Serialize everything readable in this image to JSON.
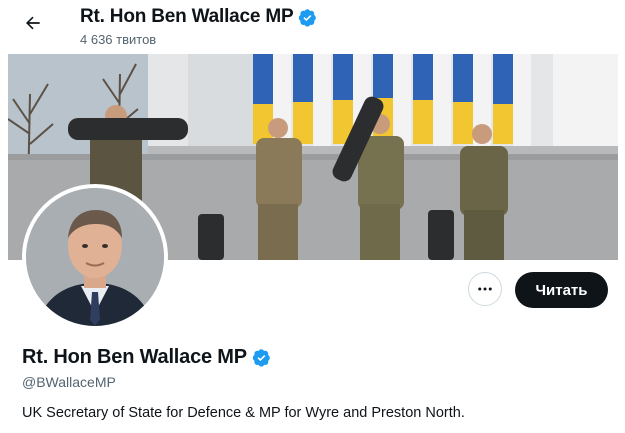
{
  "header": {
    "back_icon": "arrow-left-icon",
    "title": "Rt. Hon Ben Wallace MP",
    "tweet_count": "4 636 твитов",
    "verified_icon": "verified-badge-icon"
  },
  "banner": {
    "description_icon": "banner-photo"
  },
  "profile": {
    "name": "Rt. Hon Ben Wallace MP",
    "handle": "@BWallaceMP",
    "bio": "UK Secretary of State for Defence & MP for Wyre and Preston North.",
    "verified_icon": "verified-badge-icon"
  },
  "actions": {
    "more_icon": "more-horizontal-icon",
    "follow_label": "Читать"
  },
  "colors": {
    "verified_blue": "#1d9bf0",
    "follow_bg": "#0f1419",
    "secondary_text": "#536471"
  }
}
